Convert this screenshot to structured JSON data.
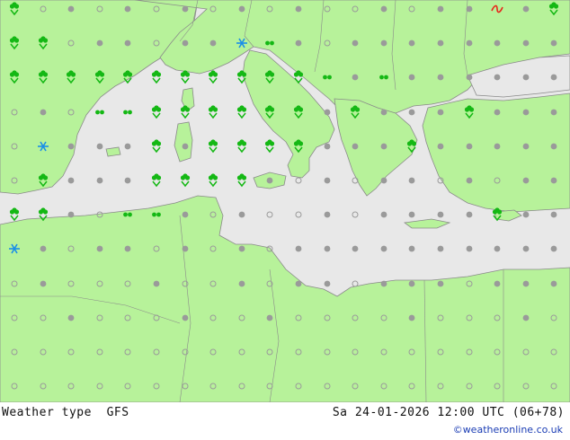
{
  "footer": {
    "title": "Weather type",
    "model": "GFS",
    "datetime": "Sa 24-01-2026 12:00 UTC (06+78)",
    "credit": "©weatheronline.co.uk"
  },
  "colors": {
    "land": "#b7f29a",
    "sea": "#e8e8e8",
    "border": "#8a8a8a",
    "rain": "#14b814",
    "snow": "#1a8fe8",
    "cloud": "#9a9a9a",
    "freezing": "#e8241a"
  },
  "legend_symbols": [
    "rain-showers",
    "rain",
    "drizzle",
    "snow",
    "freezing-rain",
    "overcast",
    "partly-cloudy",
    "clear"
  ]
}
